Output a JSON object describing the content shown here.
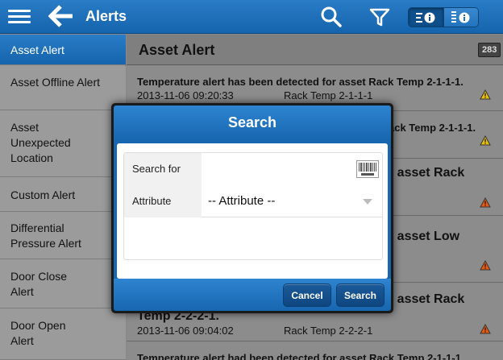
{
  "header": {
    "title": "Alerts",
    "icons": [
      "menu-icon",
      "back-arrow-icon",
      "search-icon",
      "filter-icon",
      "list-view-icon",
      "detail-view-icon"
    ],
    "accent": "#1a6fb8"
  },
  "sidebar": {
    "items": [
      {
        "label": "Asset Alert",
        "active": true
      },
      {
        "label": "Asset Offline Alert"
      },
      {
        "label": "Asset Unexpected Location"
      },
      {
        "label": "Custom Alert"
      },
      {
        "label": "Differential Pressure Alert"
      },
      {
        "label": "Door Close Alert"
      },
      {
        "label": "Door Open Alert"
      }
    ]
  },
  "main": {
    "title": "Asset Alert",
    "count": "283",
    "alerts": [
      {
        "text": "Temperature alert has been detected for asset Rack Temp 2-1-1-1.",
        "date": "2013-11-06 09:20:33",
        "asset": "Rack Temp 2-1-1-1",
        "severity": "warning"
      },
      {
        "text": "ack Temp 2-1-1-1.",
        "date": "",
        "asset": "",
        "severity": "warning"
      },
      {
        "text": "r asset Rack",
        "date": "",
        "asset": "",
        "severity": "critical"
      },
      {
        "text": "r asset Low",
        "date": "",
        "asset": "",
        "severity": "critical"
      },
      {
        "text_left": "Temp 2-2-2-1.",
        "text": "r asset Rack",
        "date": "2013-11-06 09:04:02",
        "asset": "Rack Temp 2-2-2-1",
        "severity": "critical"
      },
      {
        "text": "Temperature alert had been detected for asset Rack Temp 2-1-1-1",
        "date": "",
        "asset": "",
        "severity": ""
      }
    ]
  },
  "dialog": {
    "title": "Search",
    "search_label": "Search for",
    "search_value": "",
    "attribute_label": "Attribute",
    "attribute_value": "-- Attribute --",
    "cancel_label": "Cancel",
    "search_button_label": "Search"
  }
}
